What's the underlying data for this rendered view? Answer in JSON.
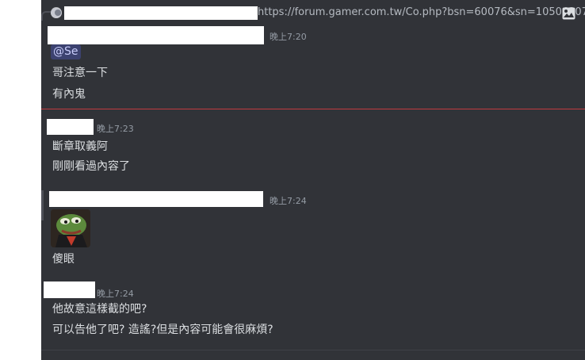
{
  "reply": {
    "link": "https://forum.gamer.com.tw/Co.php?bsn=60076&sn=105063078"
  },
  "messages": [
    {
      "time": "晚上7:20",
      "mention": "@Se",
      "lines": [
        "哥注意一下",
        "有內鬼"
      ]
    },
    {
      "time": "晚上7:23",
      "lines": [
        "斷章取義阿",
        "剛剛看過內容了"
      ]
    },
    {
      "time": "晚上7:24",
      "lines": [
        "傻眼"
      ],
      "sticker": "pepe-frog-sticker"
    },
    {
      "time": "晚上7:24",
      "lines": [
        "他故意這樣截的吧?",
        "可以告他了吧? 造謠?但是內容可能會很麻煩?"
      ]
    }
  ],
  "colors": {
    "background": "#313338",
    "text": "#dbdee1",
    "timestamp": "#949ba4",
    "mention_bg": "#3c4270",
    "new_divider": "#f23f43"
  },
  "icons": [
    "image-icon",
    "reply-avatar-icon"
  ]
}
